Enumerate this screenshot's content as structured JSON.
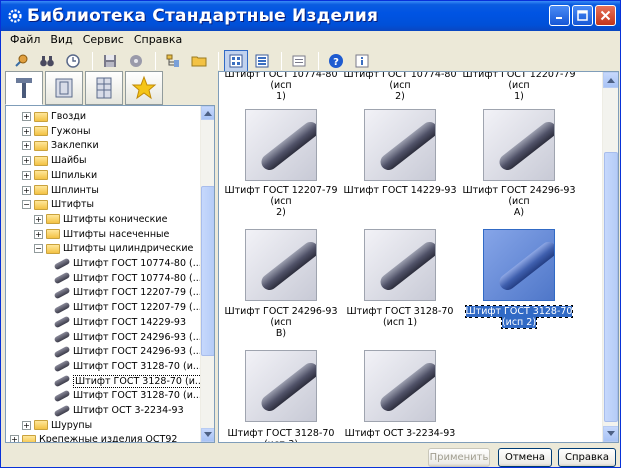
{
  "window": {
    "title": "Библиотека Стандартные Изделия",
    "icon": "gear-icon"
  },
  "menu": [
    "Файл",
    "Вид",
    "Сервис",
    "Справка"
  ],
  "toolbar": [
    "pin-icon",
    "binoculars-icon",
    "clock-icon",
    "save-icon",
    "disk-icon",
    "tree-icon",
    "folder-icon",
    "large-icons-icon",
    "list-icon",
    "details-icon",
    "help-icon",
    "info-icon"
  ],
  "tree": {
    "items": [
      {
        "label": "Гвозди",
        "level": 1,
        "type": "folder",
        "exp": "+"
      },
      {
        "label": "Гужоны",
        "level": 1,
        "type": "folder",
        "exp": "+"
      },
      {
        "label": "Заклепки",
        "level": 1,
        "type": "folder",
        "exp": "+"
      },
      {
        "label": "Шайбы",
        "level": 1,
        "type": "folder",
        "exp": "+"
      },
      {
        "label": "Шпильки",
        "level": 1,
        "type": "folder",
        "exp": "+"
      },
      {
        "label": "Шплинты",
        "level": 1,
        "type": "folder",
        "exp": "+"
      },
      {
        "label": "Штифты",
        "level": 1,
        "type": "folder",
        "exp": "−"
      },
      {
        "label": "Штифты конические",
        "level": 2,
        "type": "folder",
        "exp": "+"
      },
      {
        "label": "Штифты насеченные",
        "level": 2,
        "type": "folder",
        "exp": "+"
      },
      {
        "label": "Штифты цилиндрические",
        "level": 2,
        "type": "folder",
        "exp": "−"
      },
      {
        "label": "Штифт ГОСТ 10774-80 (...",
        "level": 3,
        "type": "item"
      },
      {
        "label": "Штифт ГОСТ 10774-80 (...",
        "level": 3,
        "type": "item"
      },
      {
        "label": "Штифт ГОСТ 12207-79 (...",
        "level": 3,
        "type": "item"
      },
      {
        "label": "Штифт ГОСТ 12207-79 (...",
        "level": 3,
        "type": "item"
      },
      {
        "label": "Штифт ГОСТ 14229-93",
        "level": 3,
        "type": "item"
      },
      {
        "label": "Штифт ГОСТ 24296-93 (...",
        "level": 3,
        "type": "item"
      },
      {
        "label": "Штифт ГОСТ 24296-93 (...",
        "level": 3,
        "type": "item"
      },
      {
        "label": "Штифт ГОСТ 3128-70 (и...",
        "level": 3,
        "type": "item"
      },
      {
        "label": "Штифт ГОСТ 3128-70 (и...",
        "level": 3,
        "type": "item",
        "selected": true
      },
      {
        "label": "Штифт ГОСТ 3128-70 (и...",
        "level": 3,
        "type": "item"
      },
      {
        "label": "Штифт ОСТ 3-2234-93",
        "level": 3,
        "type": "item"
      },
      {
        "label": "Шурупы",
        "level": 1,
        "type": "folder",
        "exp": "+"
      },
      {
        "label": "Крепежные изделия ОСТ92",
        "level": 0,
        "type": "folder",
        "exp": "+"
      }
    ]
  },
  "gallery": {
    "top_captions": [
      "Штифт ГОСТ 10774-80 (исп\n1)",
      "Штифт ГОСТ 10774-80 (исп\n2)",
      "Штифт ГОСТ 12207-79 (исп\n1)"
    ],
    "items": [
      {
        "caption": "Штифт ГОСТ 12207-79 (исп\n2)"
      },
      {
        "caption": "Штифт ГОСТ 14229-93"
      },
      {
        "caption": "Штифт ГОСТ 24296-93 (исп\nА)"
      },
      {
        "caption": "Штифт ГОСТ 24296-93 (исп\nВ)"
      },
      {
        "caption": "Штифт ГОСТ 3128-70 (исп 1)"
      },
      {
        "caption": "Штифт ГОСТ 3128-70 (исп 2)",
        "selected": true
      },
      {
        "caption": "Штифт ГОСТ 3128-70 (исп 3)"
      },
      {
        "caption": "Штифт ОСТ 3-2234-93"
      }
    ]
  },
  "buttons": {
    "apply": "Применить",
    "cancel": "Отмена",
    "help": "Справка"
  },
  "colors": {
    "titlebar": "#0054E3",
    "selection": "#316AC5",
    "face": "#ECE9D8"
  }
}
